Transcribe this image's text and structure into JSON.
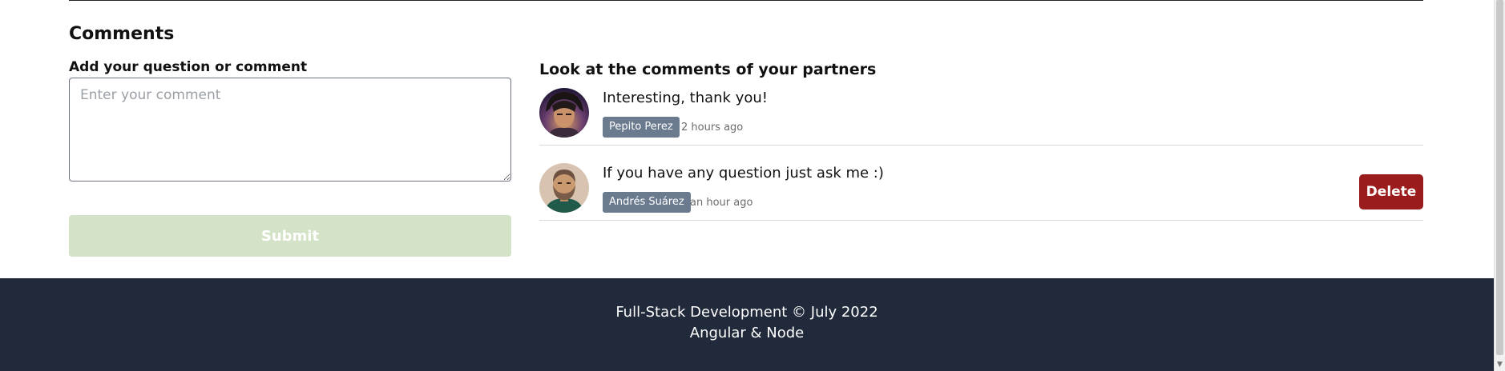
{
  "comments_section": {
    "heading": "Comments",
    "form": {
      "label": "Add your question or comment",
      "textarea": {
        "placeholder": "Enter your comment",
        "value": ""
      },
      "submit_label": "Submit"
    },
    "partners": {
      "heading": "Look at the comments of your partners",
      "items": [
        {
          "text": "Interesting, thank you!",
          "author": "Pepito Perez",
          "time": "2 hours ago",
          "avatar": "avatar-dark-hair"
        },
        {
          "text": "If you have any question just ask me :)",
          "author": "Andrés Suárez",
          "time": "an hour ago",
          "avatar": "avatar-bearded-man",
          "delete_label": "Delete"
        }
      ]
    }
  },
  "footer": {
    "line1": "Full-Stack Development © July 2022",
    "line2": "Angular & Node"
  },
  "colors": {
    "submit_disabled": "#d4e2c8",
    "delete": "#9b1c1c",
    "badge": "#6b7b8f",
    "footer_bg": "#212a3a"
  }
}
